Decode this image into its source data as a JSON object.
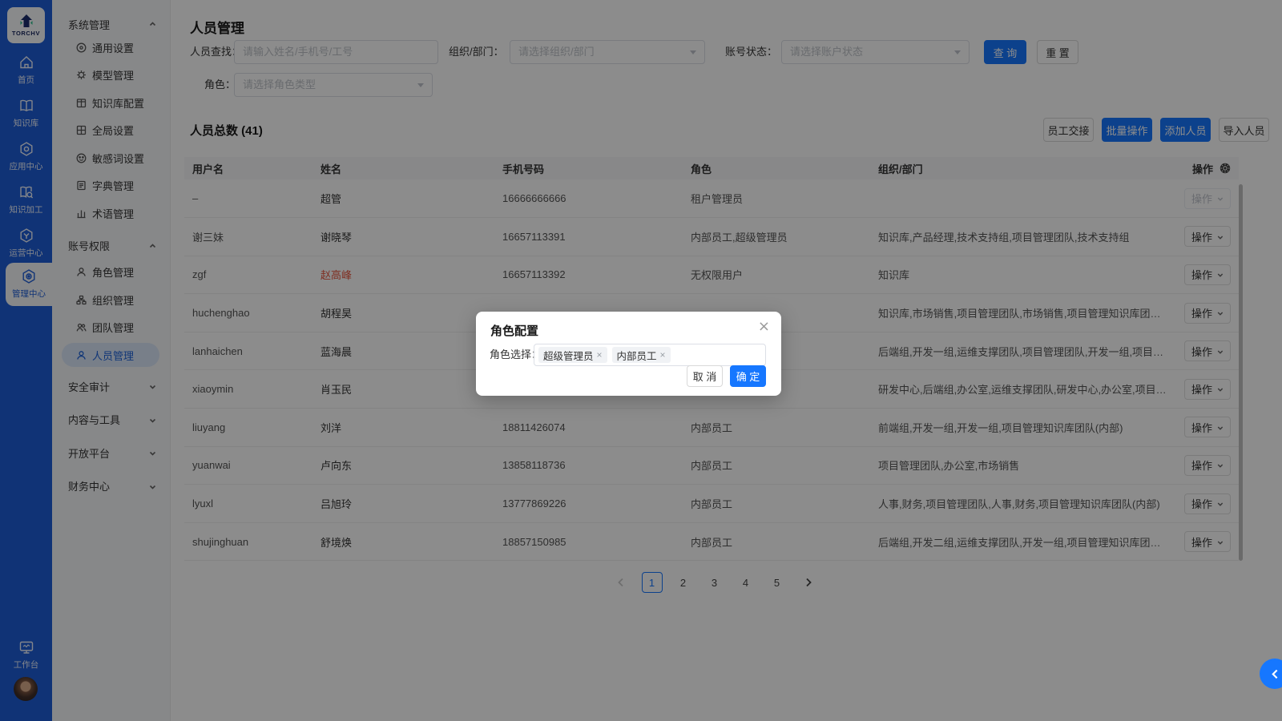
{
  "colors": {
    "accent": "#1677ff",
    "rail": "#1e5ed8",
    "warning_name": "#e8553d",
    "panel_bg": "#f6f7f9",
    "active_pill": "#dbe7fa"
  },
  "brand": {
    "logo_text": "TORCHV"
  },
  "rail": {
    "items": [
      {
        "label": "首页",
        "icon": "home-icon",
        "active": false
      },
      {
        "label": "知识库",
        "icon": "book-icon",
        "active": false
      },
      {
        "label": "应用中心",
        "icon": "app-hexagon-icon",
        "active": false
      },
      {
        "label": "知识加工",
        "icon": "book-search-icon",
        "active": false
      },
      {
        "label": "运营中心",
        "icon": "ops-hexagon-icon",
        "active": false
      },
      {
        "label": "管理中心",
        "icon": "admin-gear-icon",
        "active": true
      }
    ],
    "workbench_label": "工作台"
  },
  "sidebar": {
    "groups": [
      {
        "label": "系统管理",
        "chevron": "up",
        "items": [
          {
            "label": "通用设置",
            "icon": "circle-dot-icon",
            "active": false
          },
          {
            "label": "模型管理",
            "icon": "gear-icon",
            "active": false
          },
          {
            "label": "知识库配置",
            "icon": "book-config-icon",
            "active": false
          },
          {
            "label": "全局设置",
            "icon": "grid-icon",
            "active": false
          },
          {
            "label": "敏感词设置",
            "icon": "face-icon",
            "active": false
          },
          {
            "label": "字典管理",
            "icon": "doc-icon",
            "active": false
          },
          {
            "label": "术语管理",
            "icon": "bars-icon",
            "active": false
          }
        ]
      },
      {
        "label": "账号权限",
        "chevron": "up",
        "items": [
          {
            "label": "角色管理",
            "icon": "person-icon",
            "active": false
          },
          {
            "label": "组织管理",
            "icon": "org-tree-icon",
            "active": false
          },
          {
            "label": "团队管理",
            "icon": "team-icon",
            "active": false
          },
          {
            "label": "人员管理",
            "icon": "person-icon",
            "active": true
          }
        ]
      },
      {
        "label": "安全审计",
        "chevron": "down",
        "items": []
      },
      {
        "label": "内容与工具",
        "chevron": "down",
        "items": []
      },
      {
        "label": "开放平台",
        "chevron": "down",
        "items": []
      },
      {
        "label": "财务中心",
        "chevron": "down",
        "items": []
      }
    ]
  },
  "header": {
    "title": "人员管理"
  },
  "filters": {
    "person_label": "人员查找：",
    "person_placeholder": "请输入姓名/手机号/工号",
    "org_label": "组织/部门：",
    "org_placeholder": "请选择组织/部门",
    "status_label": "账号状态：",
    "status_placeholder": "请选择账户状态",
    "role_label": "角色：",
    "role_placeholder": "请选择角色类型",
    "search_button": "查 询",
    "reset_button": "重 置"
  },
  "toolbar": {
    "total_label": "人员总数 (41)",
    "handover_button": "员工交接",
    "batch_button": "批量操作",
    "add_button": "添加人员",
    "import_button": "导入人员"
  },
  "table": {
    "columns": [
      "用户名",
      "姓名",
      "手机号码",
      "角色",
      "组织/部门",
      "操作"
    ],
    "action_label": "操作",
    "rows": [
      {
        "username": "–",
        "name": "超管",
        "phone": "16666666666",
        "role": "租户管理员",
        "org": "",
        "red": false,
        "disabled": true
      },
      {
        "username": "谢三妹",
        "name": "谢晓琴",
        "phone": "16657113391",
        "role": "内部员工,超级管理员",
        "org": "知识库,产品经理,技术支持组,项目管理团队,技术支持组",
        "red": false,
        "disabled": false
      },
      {
        "username": "zgf",
        "name": "赵高峰",
        "phone": "16657113392",
        "role": "无权限用户",
        "org": "知识库",
        "red": true,
        "disabled": false
      },
      {
        "username": "huchenghao",
        "name": "胡程昊",
        "phone": "",
        "role": "",
        "org": "知识库,市场销售,项目管理团队,市场销售,项目管理知识库团…",
        "red": false,
        "disabled": false
      },
      {
        "username": "lanhaichen",
        "name": "蓝海晨",
        "phone": "",
        "role": "",
        "org": "后端组,开发一组,运维支撑团队,项目管理团队,开发一组,项目…",
        "red": false,
        "disabled": false
      },
      {
        "username": "xiaoymin",
        "name": "肖玉民",
        "phone": "",
        "role": "",
        "org": "研发中心,后端组,办公室,运维支撑团队,研发中心,办公室,项目…",
        "red": false,
        "disabled": false
      },
      {
        "username": "liuyang",
        "name": "刘洋",
        "phone": "18811426074",
        "role": "内部员工",
        "org": "前端组,开发一组,开发一组,项目管理知识库团队(内部)",
        "red": false,
        "disabled": false
      },
      {
        "username": "yuanwai",
        "name": "卢向东",
        "phone": "13858118736",
        "role": "内部员工",
        "org": "项目管理团队,办公室,市场销售",
        "red": false,
        "disabled": false
      },
      {
        "username": "lyuxl",
        "name": "吕旭玲",
        "phone": "13777869226",
        "role": "内部员工",
        "org": "人事,财务,项目管理团队,人事,财务,项目管理知识库团队(内部)",
        "red": false,
        "disabled": false
      },
      {
        "username": "shujinghuan",
        "name": "舒境焕",
        "phone": "18857150985",
        "role": "内部员工",
        "org": "后端组,开发二组,运维支撑团队,开发一组,项目管理知识库团…",
        "red": false,
        "disabled": false
      }
    ]
  },
  "pagination": {
    "pages": [
      "1",
      "2",
      "3",
      "4",
      "5"
    ],
    "current": "1"
  },
  "modal": {
    "title": "角色配置",
    "field_label": "角色选择：",
    "tags": [
      "超级管理员",
      "内部员工"
    ],
    "cancel_button": "取 消",
    "confirm_button": "确 定"
  }
}
